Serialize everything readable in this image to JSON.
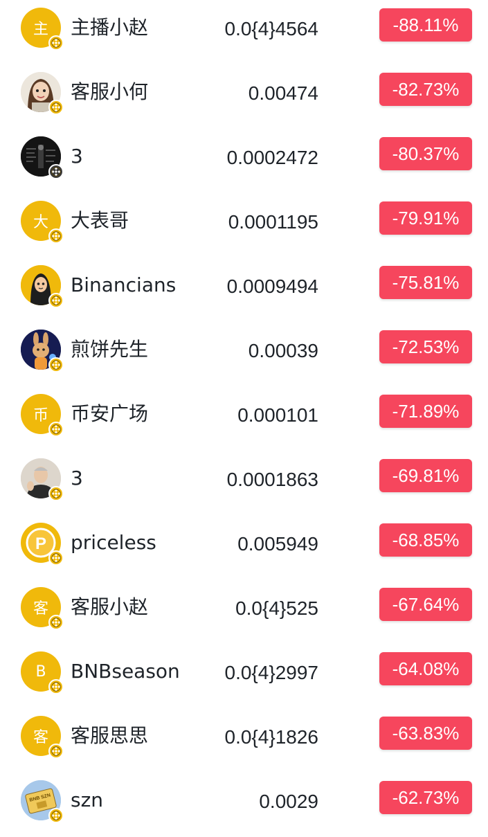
{
  "colors": {
    "negative": "#f6465d",
    "avatar_yellow": "#f0b90b",
    "text": "#1e2329"
  },
  "rows": [
    {
      "avatar": {
        "type": "letter",
        "letter": "主"
      },
      "name": "主播小赵",
      "price": "0.0{4}4564",
      "change": "-88.11%"
    },
    {
      "avatar": {
        "type": "cartoon-girl"
      },
      "name": "客服小何",
      "price": "0.00474",
      "change": "-82.73%"
    },
    {
      "avatar": {
        "type": "dark-photo"
      },
      "name": "3",
      "price": "0.0002472",
      "change": "-80.37%"
    },
    {
      "avatar": {
        "type": "letter",
        "letter": "大"
      },
      "name": "大表哥",
      "price": "0.0001195",
      "change": "-79.91%"
    },
    {
      "avatar": {
        "type": "binancian-character"
      },
      "name": "Binancians",
      "price": "0.0009494",
      "change": "-75.81%"
    },
    {
      "avatar": {
        "type": "bunny-character"
      },
      "name": "煎饼先生",
      "price": "0.00039",
      "change": "-72.53%"
    },
    {
      "avatar": {
        "type": "letter",
        "letter": "币"
      },
      "name": "币安广场",
      "price": "0.000101",
      "change": "-71.89%"
    },
    {
      "avatar": {
        "type": "person-photo"
      },
      "name": "3",
      "price": "0.0001863",
      "change": "-69.81%"
    },
    {
      "avatar": {
        "type": "p-coin",
        "letter": "P"
      },
      "name": "priceless",
      "price": "0.005949",
      "change": "-68.85%"
    },
    {
      "avatar": {
        "type": "letter",
        "letter": "客"
      },
      "name": "客服小赵",
      "price": "0.0{4}525",
      "change": "-67.64%"
    },
    {
      "avatar": {
        "type": "letter",
        "letter": "B"
      },
      "name": "BNBseason",
      "price": "0.0{4}2997",
      "change": "-64.08%"
    },
    {
      "avatar": {
        "type": "letter",
        "letter": "客"
      },
      "name": "客服思思",
      "price": "0.0{4}1826",
      "change": "-63.83%"
    },
    {
      "avatar": {
        "type": "bnb-szn-card",
        "letter": "BNB SZN"
      },
      "name": "szn",
      "price": "0.0029",
      "change": "-62.73%"
    }
  ]
}
